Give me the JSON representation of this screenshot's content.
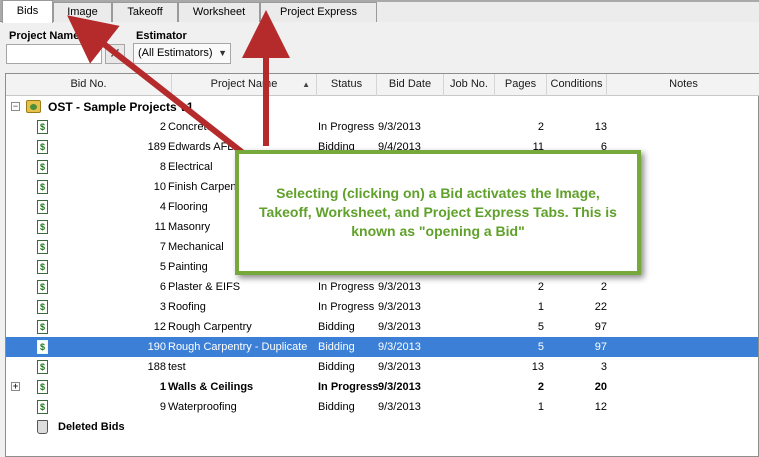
{
  "tabs": [
    {
      "label": "Bids",
      "active": true
    },
    {
      "label": "Image",
      "active": false
    },
    {
      "label": "Takeoff",
      "active": false
    },
    {
      "label": "Worksheet",
      "active": false
    },
    {
      "label": "Project Express",
      "active": false
    }
  ],
  "filters": {
    "project_name_label": "Project Name",
    "project_name_value": "",
    "clear_label": "✕",
    "estimator_label": "Estimator",
    "estimator_value": "(All Estimators)"
  },
  "grid": {
    "columns": [
      "Bid No.",
      "Project Name",
      "Status",
      "Bid Date",
      "Job No.",
      "Pages",
      "Conditions",
      "Notes"
    ],
    "group": {
      "title": "OST - Sample Projects v1"
    },
    "rows": [
      {
        "bid_no": "2",
        "name": "Concrete",
        "status": "In Progress",
        "date": "9/3/2013",
        "job": "",
        "pages": "2",
        "conditions": "13"
      },
      {
        "bid_no": "189",
        "name": "Edwards AFB",
        "status": "Bidding",
        "date": "9/4/2013",
        "job": "",
        "pages": "11",
        "conditions": "6"
      },
      {
        "bid_no": "8",
        "name": "Electrical",
        "status": "",
        "date": "",
        "job": "",
        "pages": "",
        "conditions": ""
      },
      {
        "bid_no": "10",
        "name": "Finish Carpentry",
        "status": "",
        "date": "",
        "job": "",
        "pages": "",
        "conditions": ""
      },
      {
        "bid_no": "4",
        "name": "Flooring",
        "status": "",
        "date": "",
        "job": "",
        "pages": "",
        "conditions": ""
      },
      {
        "bid_no": "11",
        "name": "Masonry",
        "status": "",
        "date": "",
        "job": "",
        "pages": "",
        "conditions": ""
      },
      {
        "bid_no": "7",
        "name": "Mechanical",
        "status": "",
        "date": "",
        "job": "",
        "pages": "",
        "conditions": ""
      },
      {
        "bid_no": "5",
        "name": "Painting",
        "status": "",
        "date": "",
        "job": "",
        "pages": "",
        "conditions": ""
      },
      {
        "bid_no": "6",
        "name": "Plaster & EIFS",
        "status": "In Progress",
        "date": "9/3/2013",
        "job": "",
        "pages": "2",
        "conditions": "2"
      },
      {
        "bid_no": "3",
        "name": "Roofing",
        "status": "In Progress",
        "date": "9/3/2013",
        "job": "",
        "pages": "1",
        "conditions": "22"
      },
      {
        "bid_no": "12",
        "name": "Rough Carpentry",
        "status": "Bidding",
        "date": "9/3/2013",
        "job": "",
        "pages": "5",
        "conditions": "97"
      },
      {
        "bid_no": "190",
        "name": "Rough Carpentry - Duplicate",
        "status": "Bidding",
        "date": "9/3/2013",
        "job": "",
        "pages": "5",
        "conditions": "97",
        "selected": true
      },
      {
        "bid_no": "188",
        "name": "test",
        "status": "Bidding",
        "date": "9/3/2013",
        "job": "",
        "pages": "13",
        "conditions": "3"
      },
      {
        "bid_no": "1",
        "name": "Walls & Ceilings",
        "status": "In Progress",
        "date": "9/3/2013",
        "job": "",
        "pages": "2",
        "conditions": "20",
        "bold": true,
        "expandable": true
      },
      {
        "bid_no": "9",
        "name": "Waterproofing",
        "status": "Bidding",
        "date": "9/3/2013",
        "job": "",
        "pages": "1",
        "conditions": "12"
      }
    ],
    "deleted_label": "Deleted Bids"
  },
  "callout": {
    "text": "Selecting (clicking on) a Bid activates the Image, Takeoff, Worksheet, and Project Express Tabs. This is known as \"opening a Bid\""
  },
  "colors": {
    "callout_border": "#77a83c",
    "callout_text": "#5fa12a",
    "arrow": "#b52a2a",
    "selection": "#3b7fd6"
  }
}
